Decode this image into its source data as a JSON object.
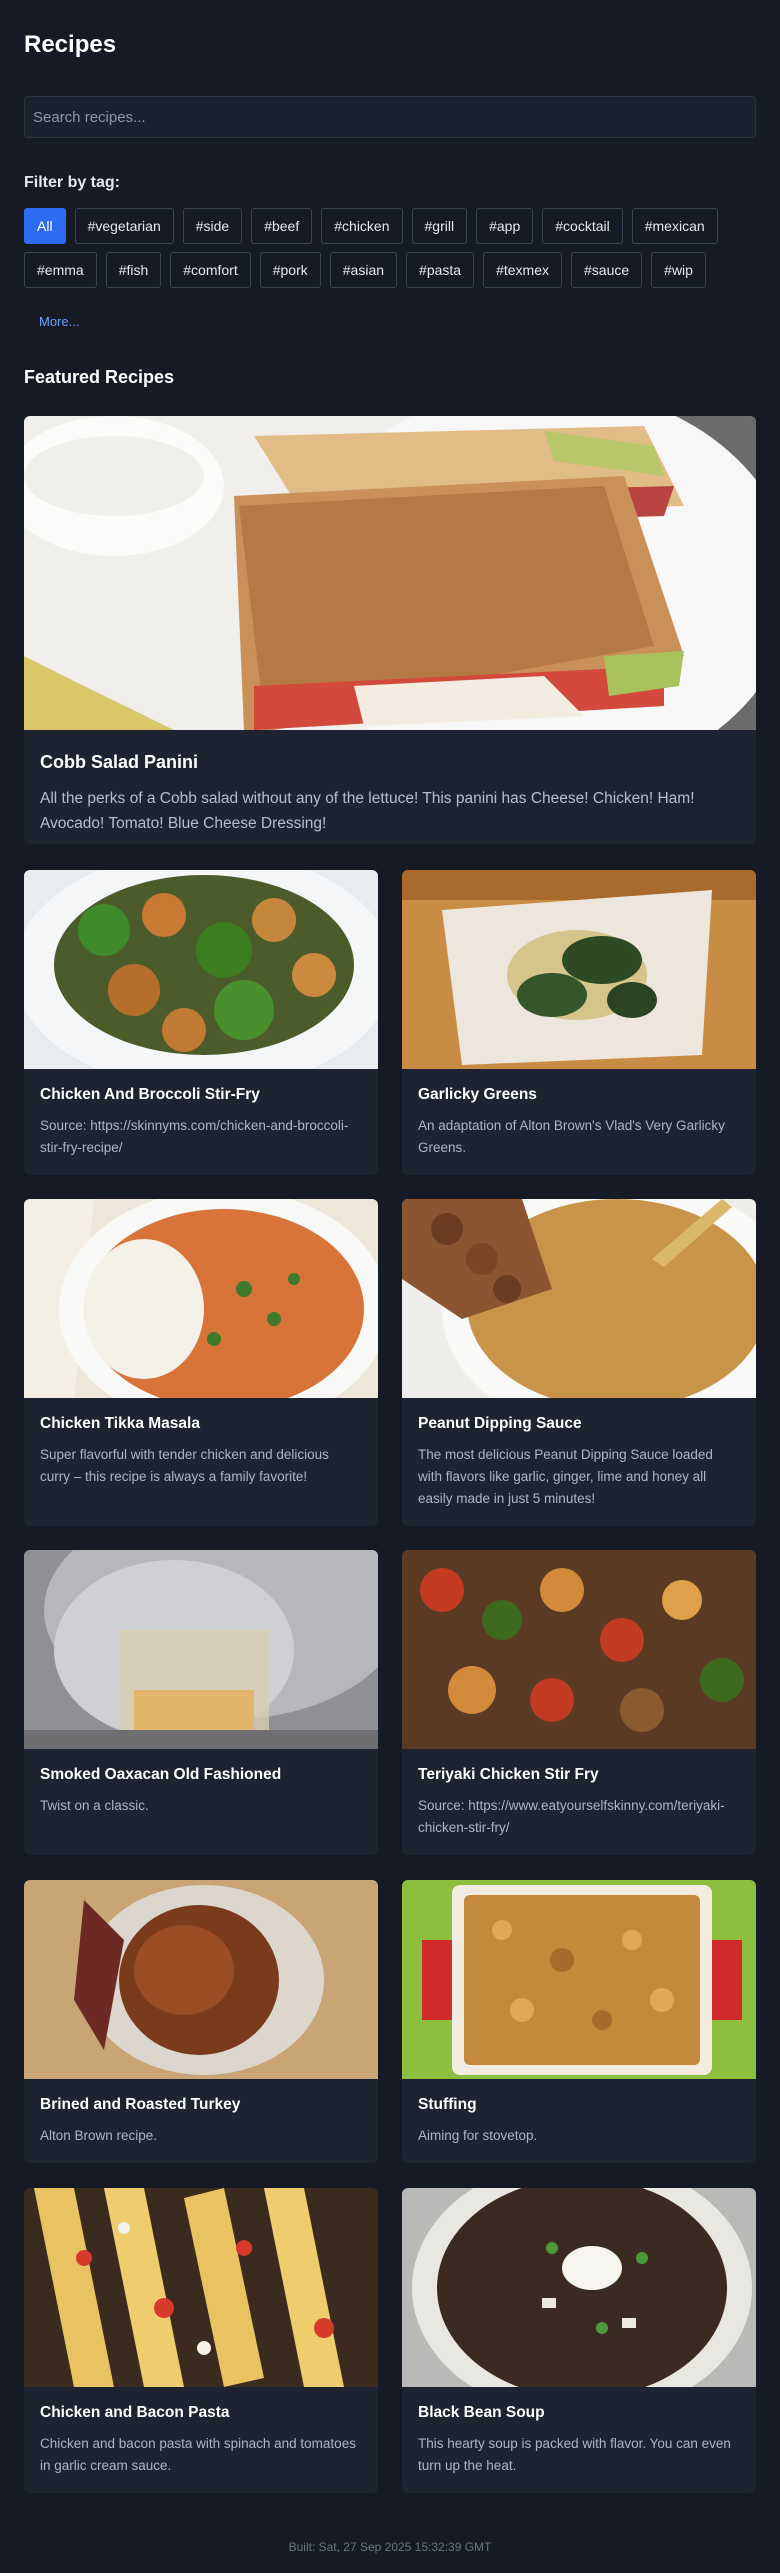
{
  "title": "Recipes",
  "search": {
    "placeholder": "Search recipes..."
  },
  "filter_label": "Filter by tag:",
  "tags": [
    "All",
    "#vegetarian",
    "#side",
    "#beef",
    "#chicken",
    "#grill",
    "#app",
    "#cocktail",
    "#mexican",
    "#emma",
    "#fish",
    "#comfort",
    "#pork",
    "#asian",
    "#pasta",
    "#texmex",
    "#sauce",
    "#wip"
  ],
  "active_tag": "All",
  "more_label": "More...",
  "featured_heading": "Featured Recipes",
  "featured": {
    "name": "Cobb Salad Panini",
    "description": "All the perks of a Cobb salad without any of the lettuce! This panini has Cheese! Chicken! Ham! Avocado! Tomato! Blue Cheese Dressing!"
  },
  "recipes": [
    {
      "name": "Chicken And Broccoli Stir-Fry",
      "description": "Source: https://skinnyms.com/chicken-and-broccoli-stir-fry-recipe/"
    },
    {
      "name": "Garlicky Greens",
      "description": "An adaptation of Alton Brown's Vlad's Very Garlicky Greens."
    },
    {
      "name": "Chicken Tikka Masala",
      "description": "Super flavorful with tender chicken and delicious curry – this recipe is always a family favorite!"
    },
    {
      "name": "Peanut Dipping Sauce",
      "description": "The most delicious Peanut Dipping Sauce loaded with flavors like garlic, ginger, lime and honey all easily made in just 5 minutes!"
    },
    {
      "name": "Smoked Oaxacan Old Fashioned",
      "description": "Twist on a classic."
    },
    {
      "name": "Teriyaki Chicken Stir Fry",
      "description": "Source: https://www.eatyourselfskinny.com/teriyaki-chicken-stir-fry/"
    },
    {
      "name": "Brined and Roasted Turkey",
      "description": "Alton Brown recipe."
    },
    {
      "name": "Stuffing",
      "description": "Aiming for stovetop."
    },
    {
      "name": "Chicken and Bacon Pasta",
      "description": "Chicken and bacon pasta with spinach and tomatoes in garlic cream sauce."
    },
    {
      "name": "Black Bean Soup",
      "description": "This hearty soup is packed with flavor. You can even turn up the heat."
    }
  ],
  "footer": "Built: Sat, 27 Sep 2025 15:32:39 GMT",
  "colors": {
    "background": "#161a24",
    "card": "#1e2331",
    "accent": "#2d6cf0",
    "link": "#6aa5ff"
  }
}
